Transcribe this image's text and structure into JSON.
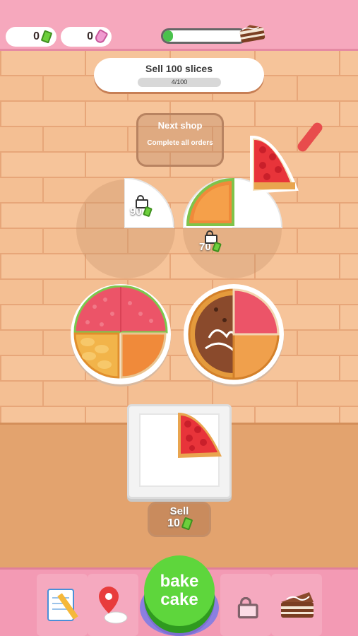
{
  "hud": {
    "cash": "0",
    "frosting": "0",
    "progress_fraction": 0.12
  },
  "quest": {
    "title": "Sell 100 slices",
    "progress_text": "4/100"
  },
  "next_shop": {
    "title": "Next shop",
    "subtitle": "Complete all orders"
  },
  "locked_plates": [
    {
      "price": "90"
    },
    {
      "price": "70"
    }
  ],
  "sell": {
    "label": "Sell",
    "price": "10"
  },
  "bake_button": {
    "line1": "bake",
    "line2": "cake"
  },
  "nav": {
    "items": [
      "orders-notepad",
      "map-pin",
      "bake-cake",
      "locked",
      "cake-slice"
    ]
  },
  "colors": {
    "topbar": "#f6a8bd",
    "bake_green": "#5ed63c",
    "progress_green": "#4ac24c",
    "wall": "#f4bf93"
  }
}
